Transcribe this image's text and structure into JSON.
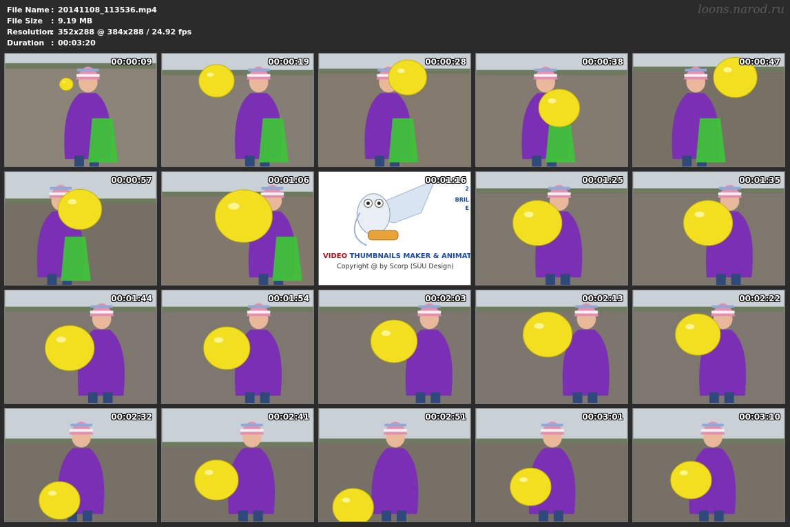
{
  "header": {
    "rows": [
      {
        "label": "File Name",
        "value": "20141108_113536.mp4"
      },
      {
        "label": "File Size",
        "value": "9.19 MB"
      },
      {
        "label": "Resolution",
        "value": "352x288 @ 384x288 / 24.92 fps"
      },
      {
        "label": "Duration",
        "value": "00:03:20"
      }
    ],
    "colon": ":"
  },
  "watermark": "loons.narod.ru",
  "logo": {
    "title_part1": "VIDEO ",
    "title_part2": "THUMBNAILS MAKER & ANIMATOR",
    "copyright": "Copyright @ by Scorp (SUU Design)",
    "side_text": [
      "2",
      "BRIL",
      "E"
    ]
  },
  "thumbnails": [
    {
      "time": "00:00:09"
    },
    {
      "time": "00:00:19"
    },
    {
      "time": "00:00:28"
    },
    {
      "time": "00:00:38"
    },
    {
      "time": "00:00:47"
    },
    {
      "time": "00:00:57"
    },
    {
      "time": "00:01:06"
    },
    {
      "time": "00:01:16"
    },
    {
      "time": "00:01:25"
    },
    {
      "time": "00:01:35"
    },
    {
      "time": "00:01:44"
    },
    {
      "time": "00:01:54"
    },
    {
      "time": "00:02:03"
    },
    {
      "time": "00:02:13"
    },
    {
      "time": "00:02:22"
    },
    {
      "time": "00:02:32"
    },
    {
      "time": "00:02:41"
    },
    {
      "time": "00:02:51"
    },
    {
      "time": "00:03:01"
    },
    {
      "time": "00:03:10"
    }
  ],
  "colors": {
    "background": "#2b2b2b",
    "jacket": "#7b2fb5",
    "balloon": "#f2e020",
    "bag": "#3fc23a",
    "ground": "#7d7468"
  }
}
